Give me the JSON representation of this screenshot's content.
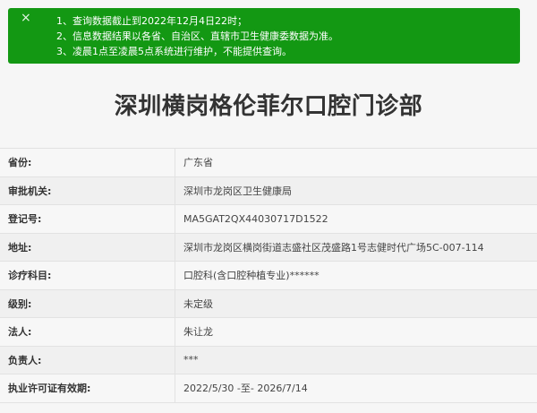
{
  "notice": {
    "close_symbol": "×",
    "lines": [
      "1、查询数据截止到2022年12月4日22时；",
      "2、信息数据结果以各省、自治区、直辖市卫生健康委数据为准。",
      "3、凌晨1点至凌晨5点系统进行维护，不能提供查询。"
    ]
  },
  "page": {
    "title": "深圳横岗格伦菲尔口腔门诊部"
  },
  "rows": [
    {
      "label": "省份:",
      "value": "广东省"
    },
    {
      "label": "审批机关:",
      "value": "深圳市龙岗区卫生健康局"
    },
    {
      "label": "登记号:",
      "value": "MA5GAT2QX44030717D1522"
    },
    {
      "label": "地址:",
      "value": "深圳市龙岗区横岗街道志盛社区茂盛路1号志健时代广场5C-007-114"
    },
    {
      "label": "诊疗科目:",
      "value": "口腔科(含口腔种植专业)******"
    },
    {
      "label": "级别:",
      "value": "未定级"
    },
    {
      "label": "法人:",
      "value": "朱让龙"
    },
    {
      "label": "负责人:",
      "value": "***"
    },
    {
      "label": "执业许可证有效期:",
      "value": "2022/5/30 -至- 2026/7/14"
    }
  ],
  "colors": {
    "notice_bg": "#139813",
    "page_bg": "#f6f6f6"
  }
}
